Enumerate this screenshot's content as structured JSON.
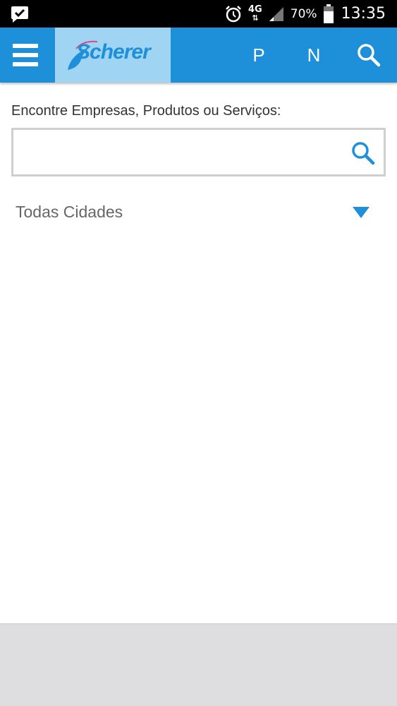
{
  "status_bar": {
    "network_type": "4G",
    "battery_percent": "70%",
    "time": "13:35"
  },
  "app_bar": {
    "logo_text": "Scherer",
    "action_p": "P",
    "action_n": "N",
    "background_color": "#1e8fd9",
    "logo_background": "#9fd4f3"
  },
  "search": {
    "label": "Encontre Empresas, Produtos ou Serviços:",
    "value": "",
    "placeholder": ""
  },
  "city_filter": {
    "selected": "Todas Cidades"
  },
  "accent_color": "#1e8fd9"
}
